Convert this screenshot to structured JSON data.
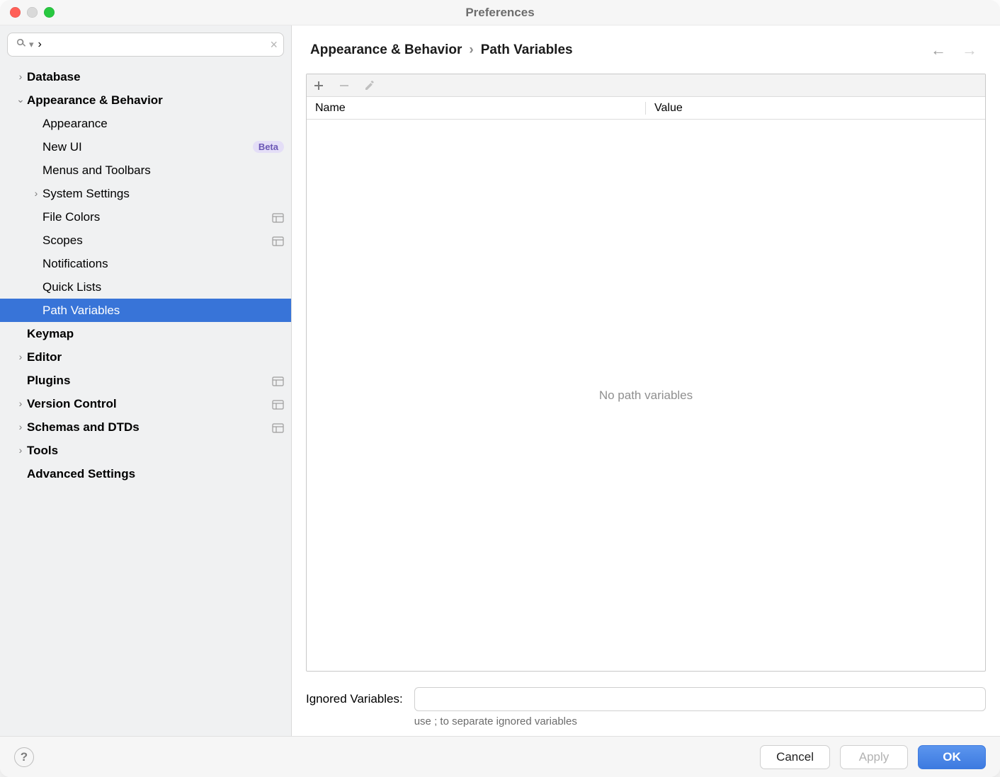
{
  "window": {
    "title": "Preferences"
  },
  "search": {
    "value": "›",
    "clear": "×"
  },
  "tree": [
    {
      "id": "database",
      "label": "Database",
      "level": 0,
      "bold": true,
      "arrow": "right"
    },
    {
      "id": "appearance-behavior",
      "label": "Appearance & Behavior",
      "level": 0,
      "bold": true,
      "arrow": "down"
    },
    {
      "id": "appearance",
      "label": "Appearance",
      "level": 1
    },
    {
      "id": "new-ui",
      "label": "New UI",
      "level": 1,
      "badge": "Beta"
    },
    {
      "id": "menus-toolbars",
      "label": "Menus and Toolbars",
      "level": 1
    },
    {
      "id": "system-settings",
      "label": "System Settings",
      "level": 1,
      "arrow": "right"
    },
    {
      "id": "file-colors",
      "label": "File Colors",
      "level": 1,
      "indicator": true
    },
    {
      "id": "scopes",
      "label": "Scopes",
      "level": 1,
      "indicator": true
    },
    {
      "id": "notifications",
      "label": "Notifications",
      "level": 1
    },
    {
      "id": "quick-lists",
      "label": "Quick Lists",
      "level": 1
    },
    {
      "id": "path-variables",
      "label": "Path Variables",
      "level": 1,
      "selected": true
    },
    {
      "id": "keymap",
      "label": "Keymap",
      "level": 0,
      "bold": true
    },
    {
      "id": "editor",
      "label": "Editor",
      "level": 0,
      "bold": true,
      "arrow": "right"
    },
    {
      "id": "plugins",
      "label": "Plugins",
      "level": 0,
      "bold": true,
      "indicator": true
    },
    {
      "id": "version-control",
      "label": "Version Control",
      "level": 0,
      "bold": true,
      "arrow": "right",
      "indicator": true
    },
    {
      "id": "schemas-dtds",
      "label": "Schemas and DTDs",
      "level": 0,
      "bold": true,
      "arrow": "right",
      "indicator": true
    },
    {
      "id": "tools",
      "label": "Tools",
      "level": 0,
      "bold": true,
      "arrow": "right"
    },
    {
      "id": "advanced-settings",
      "label": "Advanced Settings",
      "level": 0,
      "bold": true
    }
  ],
  "breadcrumb": {
    "section": "Appearance & Behavior",
    "page": "Path Variables"
  },
  "table": {
    "columns": {
      "name": "Name",
      "value": "Value"
    },
    "rows": [],
    "empty": "No path variables"
  },
  "ignored": {
    "label": "Ignored Variables:",
    "value": "",
    "hint": "use ; to separate ignored variables"
  },
  "buttons": {
    "cancel": "Cancel",
    "apply": "Apply",
    "ok": "OK"
  }
}
